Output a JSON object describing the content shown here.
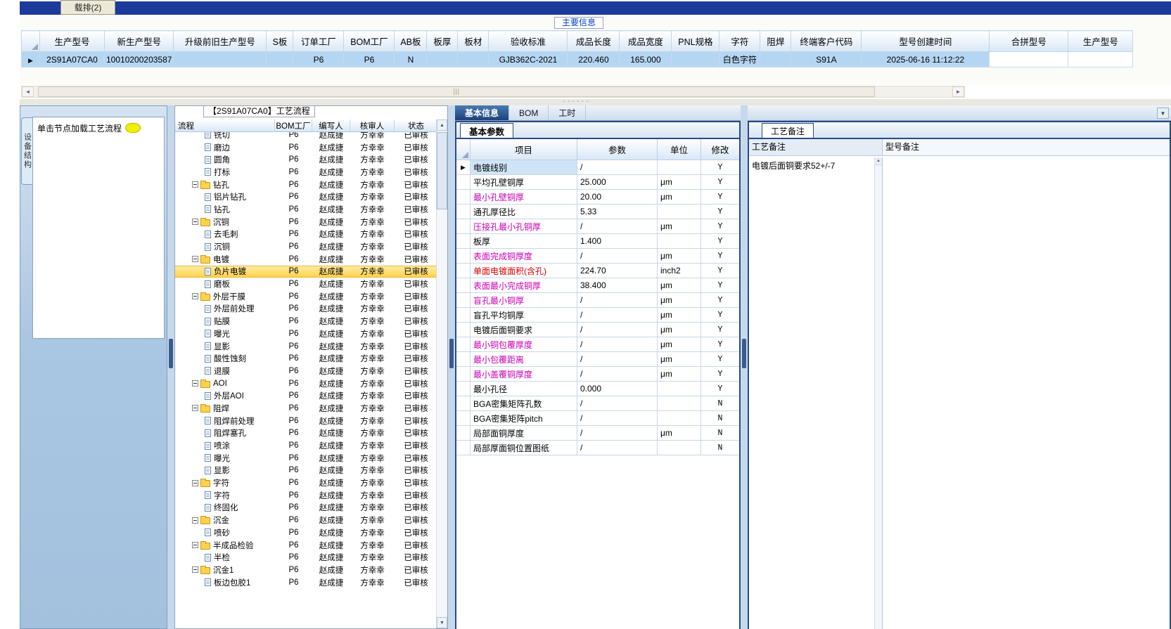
{
  "colors": {
    "accent_navy": "#1c3a99",
    "panel_border": "#2a4a85",
    "selected_row_blue": "#b5d6f2",
    "tree_highlight_yellow": "#ffd24b",
    "magenta_item": "#c800b4",
    "red_item": "#d40000"
  },
  "top_bar": {
    "fragment_label": "载排(2)"
  },
  "main_info": {
    "group_title": "主要信息",
    "columns": [
      "生产型号",
      "新生产型号",
      "升级前旧生产型号",
      "S板",
      "订单工厂",
      "BOM工厂",
      "AB板",
      "板厚",
      "板材",
      "验收标准",
      "成品长度",
      "成品宽度",
      "PNL规格",
      "字符",
      "阻焊",
      "终端客户代码",
      "型号创建时间",
      "合拼型号",
      "生产型号"
    ],
    "row": [
      "2S91A07CA0",
      "10010200203587",
      "",
      "",
      "P6",
      "P6",
      "N",
      "",
      "",
      "GJB362C-2021",
      "220.460",
      "165.000",
      "",
      "白色字符",
      "",
      "S91A",
      "2025-06-16 11:12:22",
      "",
      ""
    ]
  },
  "left_panel": {
    "vertical_tab": "设备结构",
    "hint": "单击节点加载工艺流程"
  },
  "process_flow": {
    "title": "【2S91A07CA0】工艺流程",
    "columns": [
      "流程",
      "BOM工厂",
      "编写人",
      "核审人",
      "状态"
    ],
    "row_defaults": {
      "factory": "P6",
      "author": "赵成捷",
      "reviewer": "方幸幸",
      "status": "已审核"
    },
    "nodes": [
      {
        "label": "铣切",
        "type": "file"
      },
      {
        "label": "磨边",
        "type": "file"
      },
      {
        "label": "圆角",
        "type": "file"
      },
      {
        "label": "打标",
        "type": "file"
      },
      {
        "label": "钻孔",
        "type": "folder"
      },
      {
        "label": "铝片钻孔",
        "type": "file"
      },
      {
        "label": "钻孔",
        "type": "file"
      },
      {
        "label": "沉铜",
        "type": "folder"
      },
      {
        "label": "去毛刺",
        "type": "file"
      },
      {
        "label": "沉铜",
        "type": "file"
      },
      {
        "label": "电镀",
        "type": "folder"
      },
      {
        "label": "负片电镀",
        "type": "file",
        "selected": true
      },
      {
        "label": "磨板",
        "type": "file"
      },
      {
        "label": "外层干膜",
        "type": "folder"
      },
      {
        "label": "外层前处理",
        "type": "file"
      },
      {
        "label": "贴膜",
        "type": "file"
      },
      {
        "label": "曝光",
        "type": "file"
      },
      {
        "label": "显影",
        "type": "file"
      },
      {
        "label": "酸性蚀刻",
        "type": "file"
      },
      {
        "label": "退膜",
        "type": "file"
      },
      {
        "label": "AOI",
        "type": "folder"
      },
      {
        "label": "外层AOI",
        "type": "file"
      },
      {
        "label": "阻焊",
        "type": "folder"
      },
      {
        "label": "阻焊前处理",
        "type": "file"
      },
      {
        "label": "阻焊塞孔",
        "type": "file"
      },
      {
        "label": "喷涂",
        "type": "file"
      },
      {
        "label": "曝光",
        "type": "file"
      },
      {
        "label": "显影",
        "type": "file"
      },
      {
        "label": "字符",
        "type": "folder"
      },
      {
        "label": "字符",
        "type": "file"
      },
      {
        "label": "终固化",
        "type": "file"
      },
      {
        "label": "沉金",
        "type": "folder"
      },
      {
        "label": "喷砂",
        "type": "file"
      },
      {
        "label": "半成品检验",
        "type": "folder"
      },
      {
        "label": "半检",
        "type": "file"
      },
      {
        "label": "沉金1",
        "type": "folder"
      },
      {
        "label": "板边包胶1",
        "type": "file"
      }
    ]
  },
  "detail": {
    "tabs": [
      "基本信息",
      "BOM",
      "工时"
    ],
    "active_tab": "基本信息",
    "sub_tab": "基本参数",
    "param_columns": [
      "项目",
      "参数",
      "单位",
      "修改"
    ],
    "params": [
      {
        "item": "电镀线别",
        "value": "/",
        "unit": "",
        "flag": "Y",
        "style": "normal",
        "selected": true
      },
      {
        "item": "平均孔壁铜厚",
        "value": "25.000",
        "unit": "μm",
        "flag": "Y",
        "style": "normal"
      },
      {
        "item": "最小孔壁铜厚",
        "value": "20.00",
        "unit": "μm",
        "flag": "Y",
        "style": "magenta"
      },
      {
        "item": "通孔厚径比",
        "value": "5.33",
        "unit": "",
        "flag": "Y",
        "style": "normal"
      },
      {
        "item": "压接孔最小孔铜厚",
        "value": "/",
        "unit": "μm",
        "flag": "Y",
        "style": "magenta"
      },
      {
        "item": "板厚",
        "value": "1.400",
        "unit": "",
        "flag": "Y",
        "style": "normal"
      },
      {
        "item": "表面完成铜厚度",
        "value": "/",
        "unit": "μm",
        "flag": "Y",
        "style": "magenta"
      },
      {
        "item": "单面电镀面积(含孔)",
        "value": "224.70",
        "unit": "inch2",
        "flag": "Y",
        "style": "red"
      },
      {
        "item": "表面最小完成铜厚",
        "value": "38.400",
        "unit": "μm",
        "flag": "Y",
        "style": "magenta"
      },
      {
        "item": "盲孔最小铜厚",
        "value": "/",
        "unit": "μm",
        "flag": "Y",
        "style": "magenta"
      },
      {
        "item": "盲孔平均铜厚",
        "value": "/",
        "unit": "μm",
        "flag": "Y",
        "style": "normal"
      },
      {
        "item": "电镀后面铜要求",
        "value": "/",
        "unit": "μm",
        "flag": "Y",
        "style": "normal"
      },
      {
        "item": "最小铜包覆厚度",
        "value": "/",
        "unit": "μm",
        "flag": "Y",
        "style": "magenta"
      },
      {
        "item": "最小包覆距离",
        "value": "/",
        "unit": "μm",
        "flag": "Y",
        "style": "magenta"
      },
      {
        "item": "最小盖覆铜厚度",
        "value": "/",
        "unit": "μm",
        "flag": "Y",
        "style": "magenta"
      },
      {
        "item": "最小孔径",
        "value": "0.000",
        "unit": "",
        "flag": "Y",
        "style": "normal"
      },
      {
        "item": "BGA密集矩阵孔数",
        "value": "/",
        "unit": "",
        "flag": "N",
        "style": "normal"
      },
      {
        "item": "BGA密集矩阵pitch",
        "value": "/",
        "unit": "",
        "flag": "N",
        "style": "normal"
      },
      {
        "item": "局部面铜厚度",
        "value": "/",
        "unit": "μm",
        "flag": "N",
        "style": "normal"
      },
      {
        "item": "局部厚面铜位置图纸",
        "value": "/",
        "unit": "",
        "flag": "N",
        "style": "normal"
      }
    ]
  },
  "notes": {
    "tab": "工艺备注",
    "col1": "工艺备注",
    "col2": "型号备注",
    "process_note": "电镀后面铜要求52+/-7",
    "model_note": ""
  }
}
